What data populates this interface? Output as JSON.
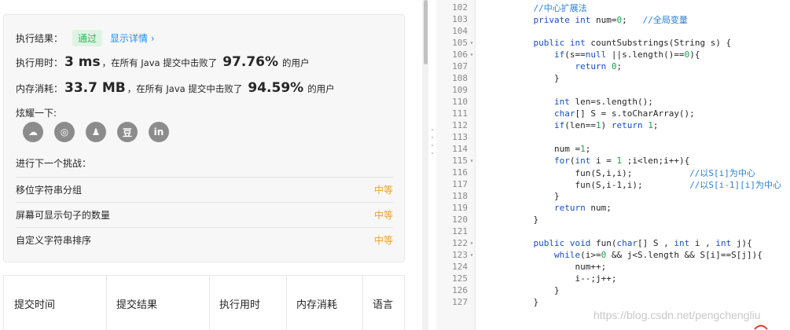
{
  "result": {
    "status_label": "执行结果：",
    "status_badge": "通过",
    "detail_link": "显示详情 ›",
    "time_label": "执行用时：",
    "time_value": "3 ms",
    "time_mid": "，在所有 Java 提交中击败了",
    "time_pct": "97.76%",
    "time_tail": "的用户",
    "mem_label": "内存消耗：",
    "mem_value": "33.7 MB",
    "mem_mid": "，在所有 Java 提交中击败了",
    "mem_pct": "94.59%",
    "mem_tail": "的用户",
    "share_label": "炫耀一下:",
    "share_icons": [
      "wechat-icon",
      "weibo-icon",
      "qq-icon",
      "douban-icon",
      "linkedin-icon"
    ],
    "share_glyphs": [
      "☁",
      "◎",
      "♟",
      "豆",
      "in"
    ]
  },
  "next": {
    "label": "进行下一个挑战：",
    "items": [
      {
        "title": "移位字符串分组",
        "difficulty": "中等"
      },
      {
        "title": "屏幕可显示句子的数量",
        "difficulty": "中等"
      },
      {
        "title": "自定义字符串排序",
        "difficulty": "中等"
      }
    ]
  },
  "table": {
    "headers": [
      "提交时间",
      "提交结果",
      "执行用时",
      "内存消耗",
      "语言"
    ]
  },
  "editor": {
    "lines": [
      {
        "n": "102",
        "fold": "",
        "indent": "    ",
        "parts": [
          [
            "cm",
            "//中心扩展法"
          ]
        ]
      },
      {
        "n": "103",
        "fold": "",
        "indent": "    ",
        "parts": [
          [
            "kw",
            "private"
          ],
          [
            "",
            " "
          ],
          [
            "kw",
            "int"
          ],
          [
            "",
            " num="
          ],
          [
            "num",
            "0"
          ],
          [
            "",
            ";   "
          ],
          [
            "cm",
            "//全局变量"
          ]
        ]
      },
      {
        "n": "104",
        "fold": "",
        "indent": "",
        "parts": []
      },
      {
        "n": "105",
        "fold": "▾",
        "indent": "    ",
        "parts": [
          [
            "kw",
            "public"
          ],
          [
            "",
            " "
          ],
          [
            "kw",
            "int"
          ],
          [
            "",
            " countSubstrings(String s) {"
          ]
        ]
      },
      {
        "n": "106",
        "fold": "▾",
        "indent": "        ",
        "parts": [
          [
            "kw",
            "if"
          ],
          [
            "",
            "(s=="
          ],
          [
            "kw",
            "null"
          ],
          [
            "",
            " ||s.length()=="
          ],
          [
            "num",
            "0"
          ],
          [
            "",
            "){"
          ]
        ]
      },
      {
        "n": "107",
        "fold": "",
        "indent": "            ",
        "parts": [
          [
            "kw",
            "return"
          ],
          [
            "",
            " "
          ],
          [
            "num",
            "0"
          ],
          [
            "",
            ";"
          ]
        ]
      },
      {
        "n": "108",
        "fold": "",
        "indent": "        ",
        "parts": [
          [
            "",
            "}"
          ]
        ]
      },
      {
        "n": "109",
        "fold": "",
        "indent": "",
        "parts": []
      },
      {
        "n": "110",
        "fold": "",
        "indent": "        ",
        "parts": [
          [
            "kw",
            "int"
          ],
          [
            "",
            " len=s.length();"
          ]
        ]
      },
      {
        "n": "111",
        "fold": "",
        "indent": "        ",
        "parts": [
          [
            "kw",
            "char"
          ],
          [
            "",
            "[] S = s.toCharArray();"
          ]
        ]
      },
      {
        "n": "112",
        "fold": "",
        "indent": "        ",
        "parts": [
          [
            "kw",
            "if"
          ],
          [
            "",
            "(len=="
          ],
          [
            "num",
            "1"
          ],
          [
            "",
            ") "
          ],
          [
            "kw",
            "return"
          ],
          [
            "",
            " "
          ],
          [
            "num",
            "1"
          ],
          [
            "",
            ";"
          ]
        ]
      },
      {
        "n": "113",
        "fold": "",
        "indent": "",
        "parts": []
      },
      {
        "n": "114",
        "fold": "",
        "indent": "        ",
        "parts": [
          [
            "",
            "num ="
          ],
          [
            "num",
            "1"
          ],
          [
            "",
            ";"
          ]
        ]
      },
      {
        "n": "115",
        "fold": "▾",
        "indent": "        ",
        "parts": [
          [
            "kw",
            "for"
          ],
          [
            "",
            "("
          ],
          [
            "kw",
            "int"
          ],
          [
            "",
            " i = "
          ],
          [
            "num",
            "1"
          ],
          [
            "",
            " ;i<len;i++){"
          ]
        ]
      },
      {
        "n": "116",
        "fold": "",
        "indent": "            ",
        "parts": [
          [
            "",
            "fun(S,i,i);           "
          ],
          [
            "cm",
            "//以S[i]为中心"
          ]
        ]
      },
      {
        "n": "117",
        "fold": "",
        "indent": "            ",
        "parts": [
          [
            "",
            "fun(S,i-1,i);         "
          ],
          [
            "cm",
            "//以S[i-1][i]为中心"
          ]
        ]
      },
      {
        "n": "118",
        "fold": "",
        "indent": "        ",
        "parts": [
          [
            "",
            "}"
          ]
        ]
      },
      {
        "n": "119",
        "fold": "",
        "indent": "        ",
        "parts": [
          [
            "kw",
            "return"
          ],
          [
            "",
            " num;"
          ]
        ]
      },
      {
        "n": "120",
        "fold": "",
        "indent": "    ",
        "parts": [
          [
            "",
            "}"
          ]
        ]
      },
      {
        "n": "121",
        "fold": "",
        "indent": "",
        "parts": []
      },
      {
        "n": "122",
        "fold": "▾",
        "indent": "    ",
        "parts": [
          [
            "kw",
            "public"
          ],
          [
            "",
            " "
          ],
          [
            "kw",
            "void"
          ],
          [
            "",
            " fun("
          ],
          [
            "kw",
            "char"
          ],
          [
            "",
            "[] S , "
          ],
          [
            "kw",
            "int"
          ],
          [
            "",
            " i , "
          ],
          [
            "kw",
            "int"
          ],
          [
            "",
            " j){"
          ]
        ]
      },
      {
        "n": "123",
        "fold": "▾",
        "indent": "        ",
        "parts": [
          [
            "kw",
            "while"
          ],
          [
            "",
            "(i>="
          ],
          [
            "num",
            "0"
          ],
          [
            "",
            " && j<S.length && S[i]==S[j]){"
          ]
        ]
      },
      {
        "n": "124",
        "fold": "",
        "indent": "            ",
        "parts": [
          [
            "",
            "num++;"
          ]
        ]
      },
      {
        "n": "125",
        "fold": "",
        "indent": "            ",
        "parts": [
          [
            "",
            "i--;j++;"
          ]
        ]
      },
      {
        "n": "126",
        "fold": "",
        "indent": "        ",
        "parts": [
          [
            "",
            "}"
          ]
        ]
      },
      {
        "n": "127",
        "fold": "",
        "indent": "    ",
        "parts": [
          [
            "",
            "}"
          ]
        ]
      }
    ]
  },
  "watermark": "https://blog.csdn.net/pengchengliu"
}
